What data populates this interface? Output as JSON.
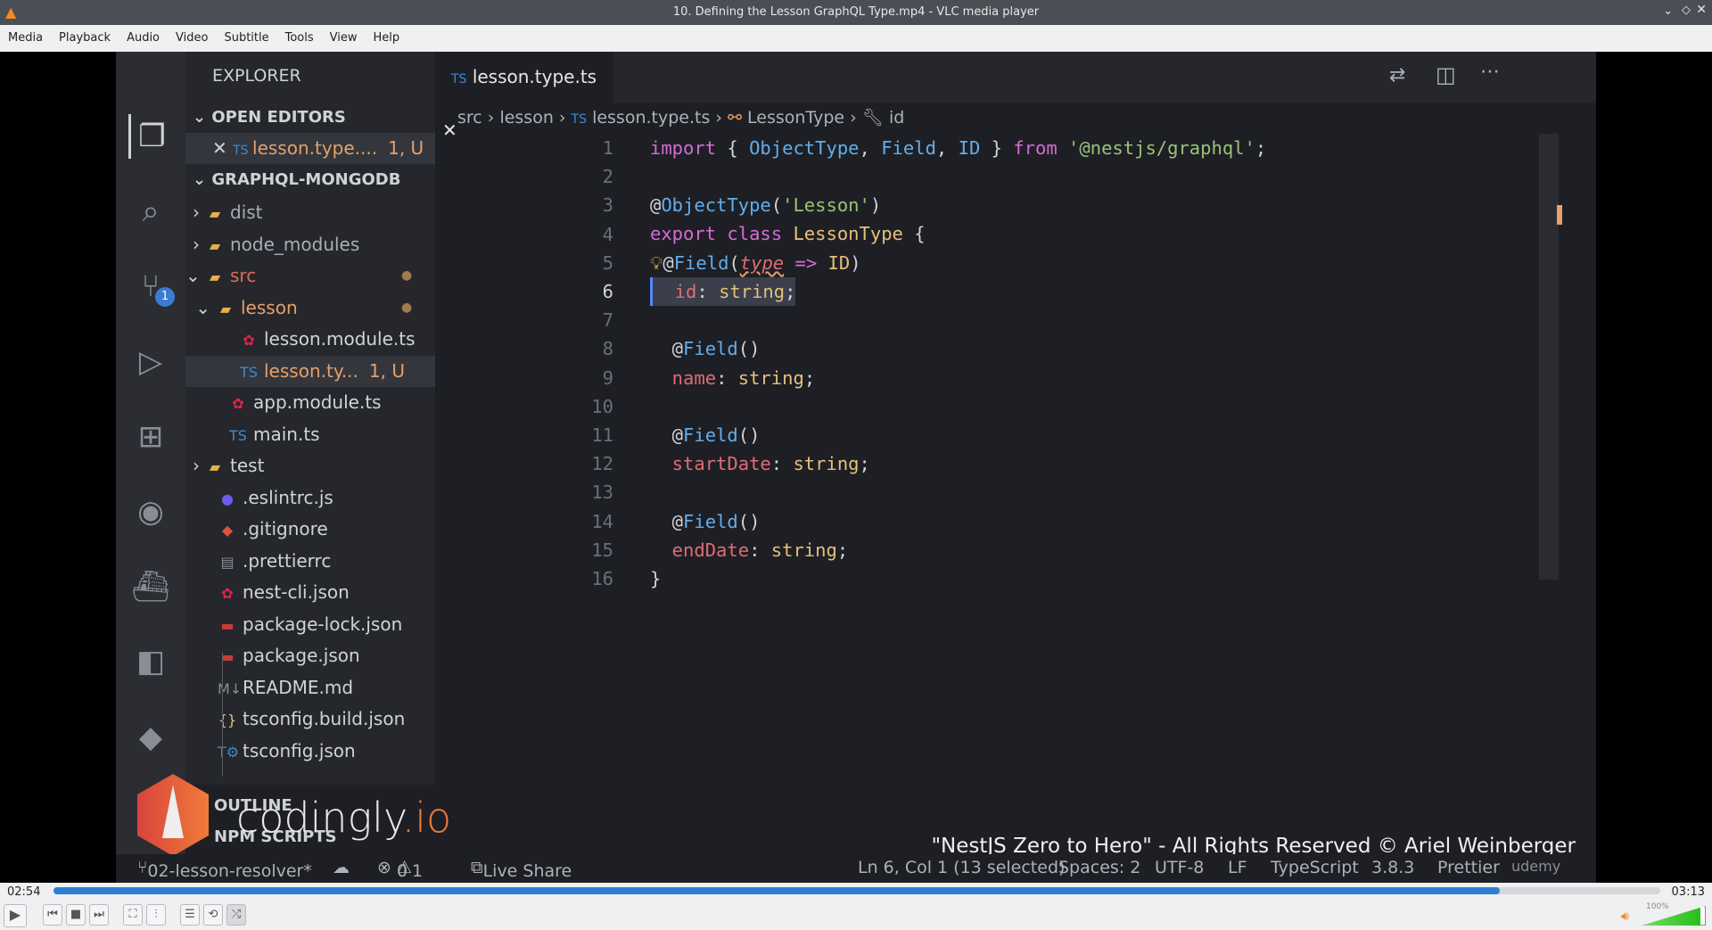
{
  "window": {
    "title": "10. Defining the Lesson GraphQL Type.mp4 - VLC media player"
  },
  "menu": [
    "Media",
    "Playback",
    "Audio",
    "Video",
    "Subtitle",
    "Tools",
    "View",
    "Help"
  ],
  "player": {
    "elapsed": "02:54",
    "total": "03:13",
    "progress": 0.9,
    "volume_label": "100%",
    "volume": 1.0,
    "accent": "#2d7fd3"
  },
  "vscode": {
    "explorer_title": "EXPLORER",
    "open_editors_label": "OPEN EDITORS",
    "open_editor": {
      "name": "lesson.type....",
      "badge": "1, U"
    },
    "project_label": "GRAPHQL-MONGODB",
    "tree": [
      {
        "name": "dist",
        "icon": "folder-icon",
        "color": "#a9adb3"
      },
      {
        "name": "node_modules",
        "icon": "folder-icon",
        "color": "#a9adb3"
      },
      {
        "name": "src",
        "icon": "folder-icon",
        "color": "#e06c55"
      },
      {
        "name": "lesson",
        "icon": "folder-icon",
        "color": "#e6a06a"
      },
      {
        "name": "lesson.module.ts",
        "icon": "nest-icon",
        "color": "#d0d3d8"
      },
      {
        "name": "lesson.ty...",
        "badge": "1, U",
        "icon": "ts-icon",
        "color": "#e6a06a"
      },
      {
        "name": "app.module.ts",
        "icon": "nest-icon",
        "color": "#d0d3d8"
      },
      {
        "name": "main.ts",
        "icon": "ts-icon",
        "color": "#d0d3d8"
      },
      {
        "name": "test",
        "icon": "folder-icon",
        "color": "#d0d3d8"
      },
      {
        "name": ".eslintrc.js",
        "icon": "eslint-icon",
        "color": "#d0d3d8"
      },
      {
        "name": ".gitignore",
        "icon": "git-icon",
        "color": "#d0d3d8"
      },
      {
        "name": ".prettierrc",
        "icon": "prettier-icon",
        "color": "#d0d3d8"
      },
      {
        "name": "nest-cli.json",
        "icon": "nest-icon",
        "color": "#d0d3d8"
      },
      {
        "name": "package-lock.json",
        "icon": "npm-icon",
        "color": "#d0d3d8"
      },
      {
        "name": "package.json",
        "icon": "npm-icon",
        "color": "#d0d3d8"
      },
      {
        "name": "README.md",
        "icon": "markdown-icon",
        "color": "#d0d3d8"
      },
      {
        "name": "tsconfig.build.json",
        "icon": "json-icon",
        "color": "#d0d3d8"
      },
      {
        "name": "tsconfig.json",
        "icon": "ts-config-icon",
        "color": "#d0d3d8"
      }
    ],
    "outline_label": "OUTLINE",
    "npm_scripts_label": "NPM SCRIPTS",
    "tab": {
      "prefix": "TS",
      "name": "lesson.type.ts"
    },
    "breadcrumb": [
      "src",
      "lesson",
      "lesson.type.ts",
      "LessonType",
      "id"
    ],
    "lines": [
      "1",
      "2",
      "3",
      "4",
      "5",
      "6",
      "7",
      "8",
      "9",
      "10",
      "11",
      "12",
      "13",
      "14",
      "15",
      "16"
    ],
    "status": {
      "branch": "02-lesson-resolver*",
      "errors": "0",
      "warnings": "1",
      "live_share": "Live Share",
      "position": "Ln 6, Col 1 (13 selected)",
      "spaces": "Spaces: 2",
      "encoding": "UTF-8",
      "eol": "LF",
      "language": "TypeScript",
      "version": "3.8.3",
      "formatter": "Prettier"
    },
    "activity_badge": "1"
  },
  "watermark": {
    "logo": "codingly.io",
    "copyright": "\"NestJS Zero to Hero\" - All Rights Reserved © Ariel Weinberger",
    "udemy": "udemy"
  }
}
